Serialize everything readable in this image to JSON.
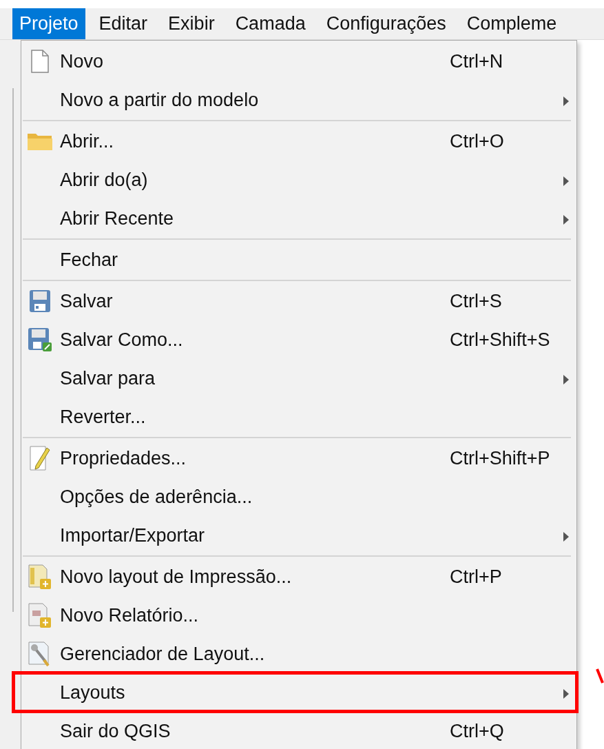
{
  "menubar": [
    {
      "label": "Projeto",
      "selected": true
    },
    {
      "label": "Editar",
      "selected": false
    },
    {
      "label": "Exibir",
      "selected": false
    },
    {
      "label": "Camada",
      "selected": false
    },
    {
      "label": "Configurações",
      "selected": false
    },
    {
      "label": "Compleme",
      "selected": false
    }
  ],
  "menu": {
    "items": [
      {
        "kind": "action",
        "label": "Novo",
        "shortcut": "Ctrl+N",
        "highlighted": false
      },
      {
        "kind": "submenu",
        "label": "Novo a partir do modelo",
        "highlighted": false
      },
      {
        "kind": "separator"
      },
      {
        "kind": "action",
        "label": "Abrir...",
        "shortcut": "Ctrl+O",
        "highlighted": false
      },
      {
        "kind": "submenu",
        "label": "Abrir do(a)",
        "highlighted": false
      },
      {
        "kind": "submenu",
        "label": "Abrir Recente",
        "highlighted": false
      },
      {
        "kind": "separator"
      },
      {
        "kind": "action",
        "label": "Fechar",
        "highlighted": false
      },
      {
        "kind": "separator"
      },
      {
        "kind": "action",
        "label": "Salvar",
        "shortcut": "Ctrl+S",
        "highlighted": false
      },
      {
        "kind": "action",
        "label": "Salvar Como...",
        "shortcut": "Ctrl+Shift+S",
        "highlighted": false
      },
      {
        "kind": "submenu",
        "label": "Salvar para",
        "highlighted": false
      },
      {
        "kind": "action",
        "label": "Reverter...",
        "highlighted": false
      },
      {
        "kind": "separator"
      },
      {
        "kind": "action",
        "label": "Propriedades...",
        "shortcut": "Ctrl+Shift+P",
        "highlighted": false
      },
      {
        "kind": "action",
        "label": "Opções de aderência...",
        "highlighted": false
      },
      {
        "kind": "submenu",
        "label": "Importar/Exportar",
        "highlighted": false
      },
      {
        "kind": "separator"
      },
      {
        "kind": "action",
        "label": "Novo layout de Impressão...",
        "shortcut": "Ctrl+P",
        "highlighted": false
      },
      {
        "kind": "action",
        "label": "Novo Relatório...",
        "highlighted": false
      },
      {
        "kind": "action",
        "label": "Gerenciador de Layout...",
        "highlighted": false
      },
      {
        "kind": "submenu",
        "label": "Layouts",
        "highlighted": true
      },
      {
        "kind": "action",
        "label": "Sair do QGIS",
        "shortcut": "Ctrl+Q",
        "highlighted": false
      }
    ]
  }
}
